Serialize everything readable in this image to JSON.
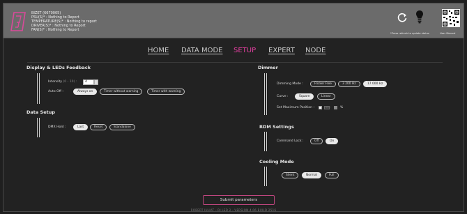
{
  "header": {
    "status_lines": [
      "BIZET (6670005)",
      "PSU(S)* : Nothing to Report",
      "TEMPERATURE(S)* : Nothing to report",
      "DRIVER(S)* : Nothing to Report",
      "FAN(S)* : Nothing to Report"
    ],
    "refresh_note": "*Press refresh to update status",
    "manual_label": "User Manual"
  },
  "nav": {
    "items": [
      {
        "label": "HOME",
        "active": false
      },
      {
        "label": "DATA MODE",
        "active": false
      },
      {
        "label": "SETUP",
        "active": true
      },
      {
        "label": "EXPERT",
        "active": false
      },
      {
        "label": "NODE",
        "active": false
      }
    ],
    "accent": "#e23fa0"
  },
  "display": {
    "title": "Display & LEDs Feedback",
    "intensity_label": "Intensity",
    "intensity_hint": "(0 - 10) :",
    "intensity_value": "4",
    "autooff_label": "Auto Off :",
    "autooff_options": [
      "Always on",
      "Timer without warning",
      "Timer with warning"
    ],
    "autooff_selected": "Always on"
  },
  "data_setup": {
    "title": "Data Setup",
    "dmx_hold_label": "DMX Hold :",
    "options": [
      "Last",
      "Reset",
      "Standalone"
    ],
    "selected": "Last"
  },
  "dimmer": {
    "title": "Dimmer",
    "mode_label": "Dimming Mode :",
    "mode_options": [
      "Flicker Free",
      "3 200 Hz",
      "17 000 Hz"
    ],
    "mode_selected": "17 000 Hz",
    "curve_label": "Curve :",
    "curve_options": [
      "Square",
      "Linear"
    ],
    "curve_selected": "Square",
    "maxpos_label": "Set Maximum Position :",
    "maxpos_value": "100",
    "maxpos_unit": "%"
  },
  "rdm": {
    "title": "RDM Settings",
    "lock_label": "Command Lock :",
    "options": [
      "Off",
      "On"
    ],
    "selected": "On"
  },
  "cooling": {
    "title": "Cooling Mode",
    "options": [
      "Silent",
      "Normal",
      "Full"
    ],
    "selected": "Normal"
  },
  "submit_label": "Submit parameters",
  "footer": "ROBERT JULIAT  -  RJ LED 2  -  VERSION 4.06 BUILD 2516"
}
